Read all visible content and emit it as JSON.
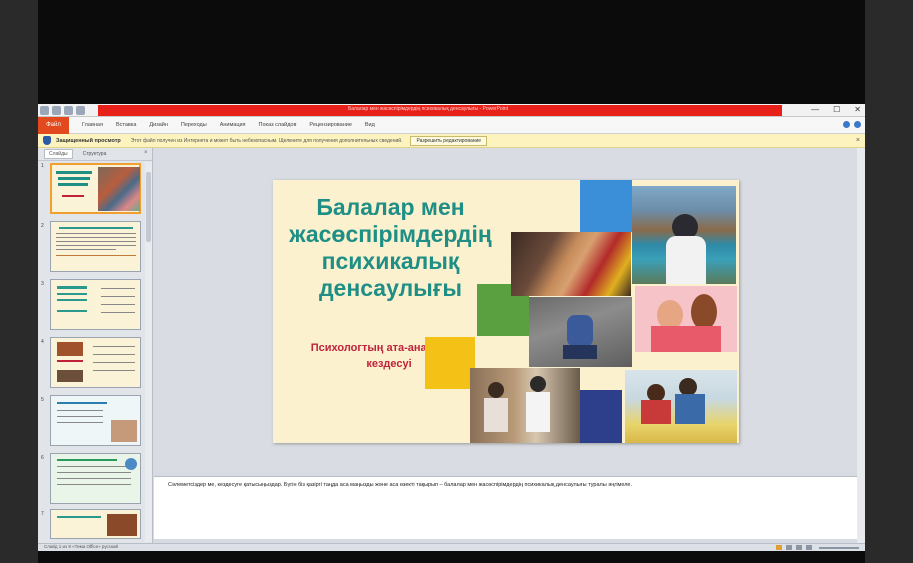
{
  "window": {
    "title": "Балалар мен жасөспірімдердің психикалық денсаулығы - PowerPoint",
    "controls": [
      "—",
      "☐",
      "✕"
    ],
    "accent_color": "#e8201a"
  },
  "ribbon": {
    "file_tab": "Файл",
    "tabs": [
      "Главная",
      "Вставка",
      "Дизайн",
      "Переходы",
      "Анимация",
      "Показ слайдов",
      "Рецензирование",
      "Вид"
    ]
  },
  "message_bar": {
    "title": "Защищенный просмотр",
    "text": "Этот файл получен из Интернета и может быть небезопасным. Щелкните для получения дополнительных сведений.",
    "button": "Разрешить редактирование",
    "close": "×"
  },
  "panel": {
    "tabs": [
      "Слайды",
      "Структура"
    ],
    "close": "×",
    "thumb_numbers": [
      "1",
      "2",
      "3",
      "4",
      "5",
      "6",
      "7"
    ]
  },
  "slide": {
    "title": "Балалар мен жасөспірімдердің психикалық денсаулығы",
    "subtitle": "Психологтың ата-аналармен кездесуі",
    "title_color": "#1f8f86",
    "subtitle_color": "#c0223a",
    "background": "#fbf1cf"
  },
  "notes": {
    "text": "Сәлеметсіздер ме, кездесуге қатысыңыздар. Бүгін біз қазіргі таңда аса маңызды және аса өзекті тақырып – балалар мен жасөспірімдердің психикалық денсаулығы туралы әңгімеле."
  },
  "status": {
    "text": "Слайд 1 из 9    «Тема Office»    русский"
  }
}
